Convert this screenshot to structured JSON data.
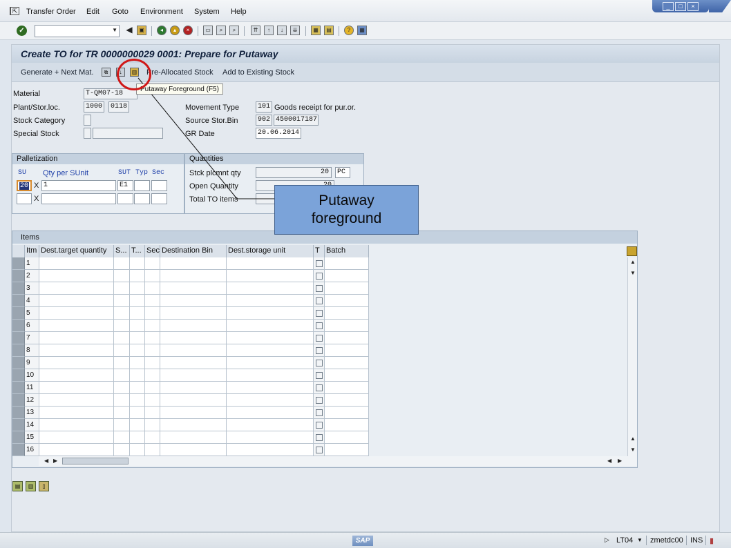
{
  "menubar": {
    "items": [
      "Transfer Order",
      "Edit",
      "Goto",
      "Environment",
      "System",
      "Help"
    ]
  },
  "window_controls": [
    "minimize",
    "maximize",
    "close"
  ],
  "window": {
    "title": "Create TO for TR 0000000029 0001: Prepare for Putaway"
  },
  "app_toolbar": {
    "generate_next": "Generate + Next Mat.",
    "pre_allocated": "Pre-Allocated Stock",
    "add_existing": "Add to Existing Stock"
  },
  "tooltip": "Putaway Foreground   (F5)",
  "callout": {
    "line1": "Putaway",
    "line2": "foreground"
  },
  "header_fields": {
    "material_label": "Material",
    "material_value": "T-QM07-18",
    "plant_label": "Plant/Stor.loc.",
    "plant_value": "1000",
    "sloc_value": "0118",
    "stock_cat_label": "Stock Category",
    "special_stock_label": "Special Stock",
    "movement_type_label": "Movement Type",
    "movement_type_value": "101",
    "movement_type_text": "Goods receipt for pur.or.",
    "source_bin_label": "Source Stor.Bin",
    "source_type_value": "902",
    "source_bin_value": "4500017187",
    "gr_date_label": "GR Date",
    "gr_date_value": "20.06.2014"
  },
  "palletization": {
    "title": "Palletization",
    "col_su": "SU",
    "col_qty": "Qty per SUnit",
    "col_sut": "SUT",
    "col_typ": "Typ",
    "col_sec": "Sec",
    "row1_su": "20",
    "row1_x": "X",
    "row1_qty": "1",
    "row1_sut": "E1",
    "row2_x": "X"
  },
  "quantities": {
    "title": "Quantities",
    "stck_label": "Stck plcmnt qty",
    "stck_value": "20",
    "stck_unit": "PC",
    "open_label": "Open Quantity",
    "open_value": "20",
    "total_label": "Total TO items"
  },
  "items": {
    "title": "Items",
    "columns": [
      "Itm",
      "Dest.target quantity",
      "S...",
      "T...",
      "Sec",
      "Destination Bin",
      "Dest.storage unit",
      "T",
      "Batch"
    ],
    "rows": [
      "1",
      "2",
      "3",
      "4",
      "5",
      "6",
      "7",
      "8",
      "9",
      "10",
      "11",
      "12",
      "13",
      "14",
      "15",
      "16"
    ]
  },
  "statusbar": {
    "logo": "SAP",
    "transaction": "LT04",
    "server": "zmetdc00",
    "mode": "INS"
  }
}
